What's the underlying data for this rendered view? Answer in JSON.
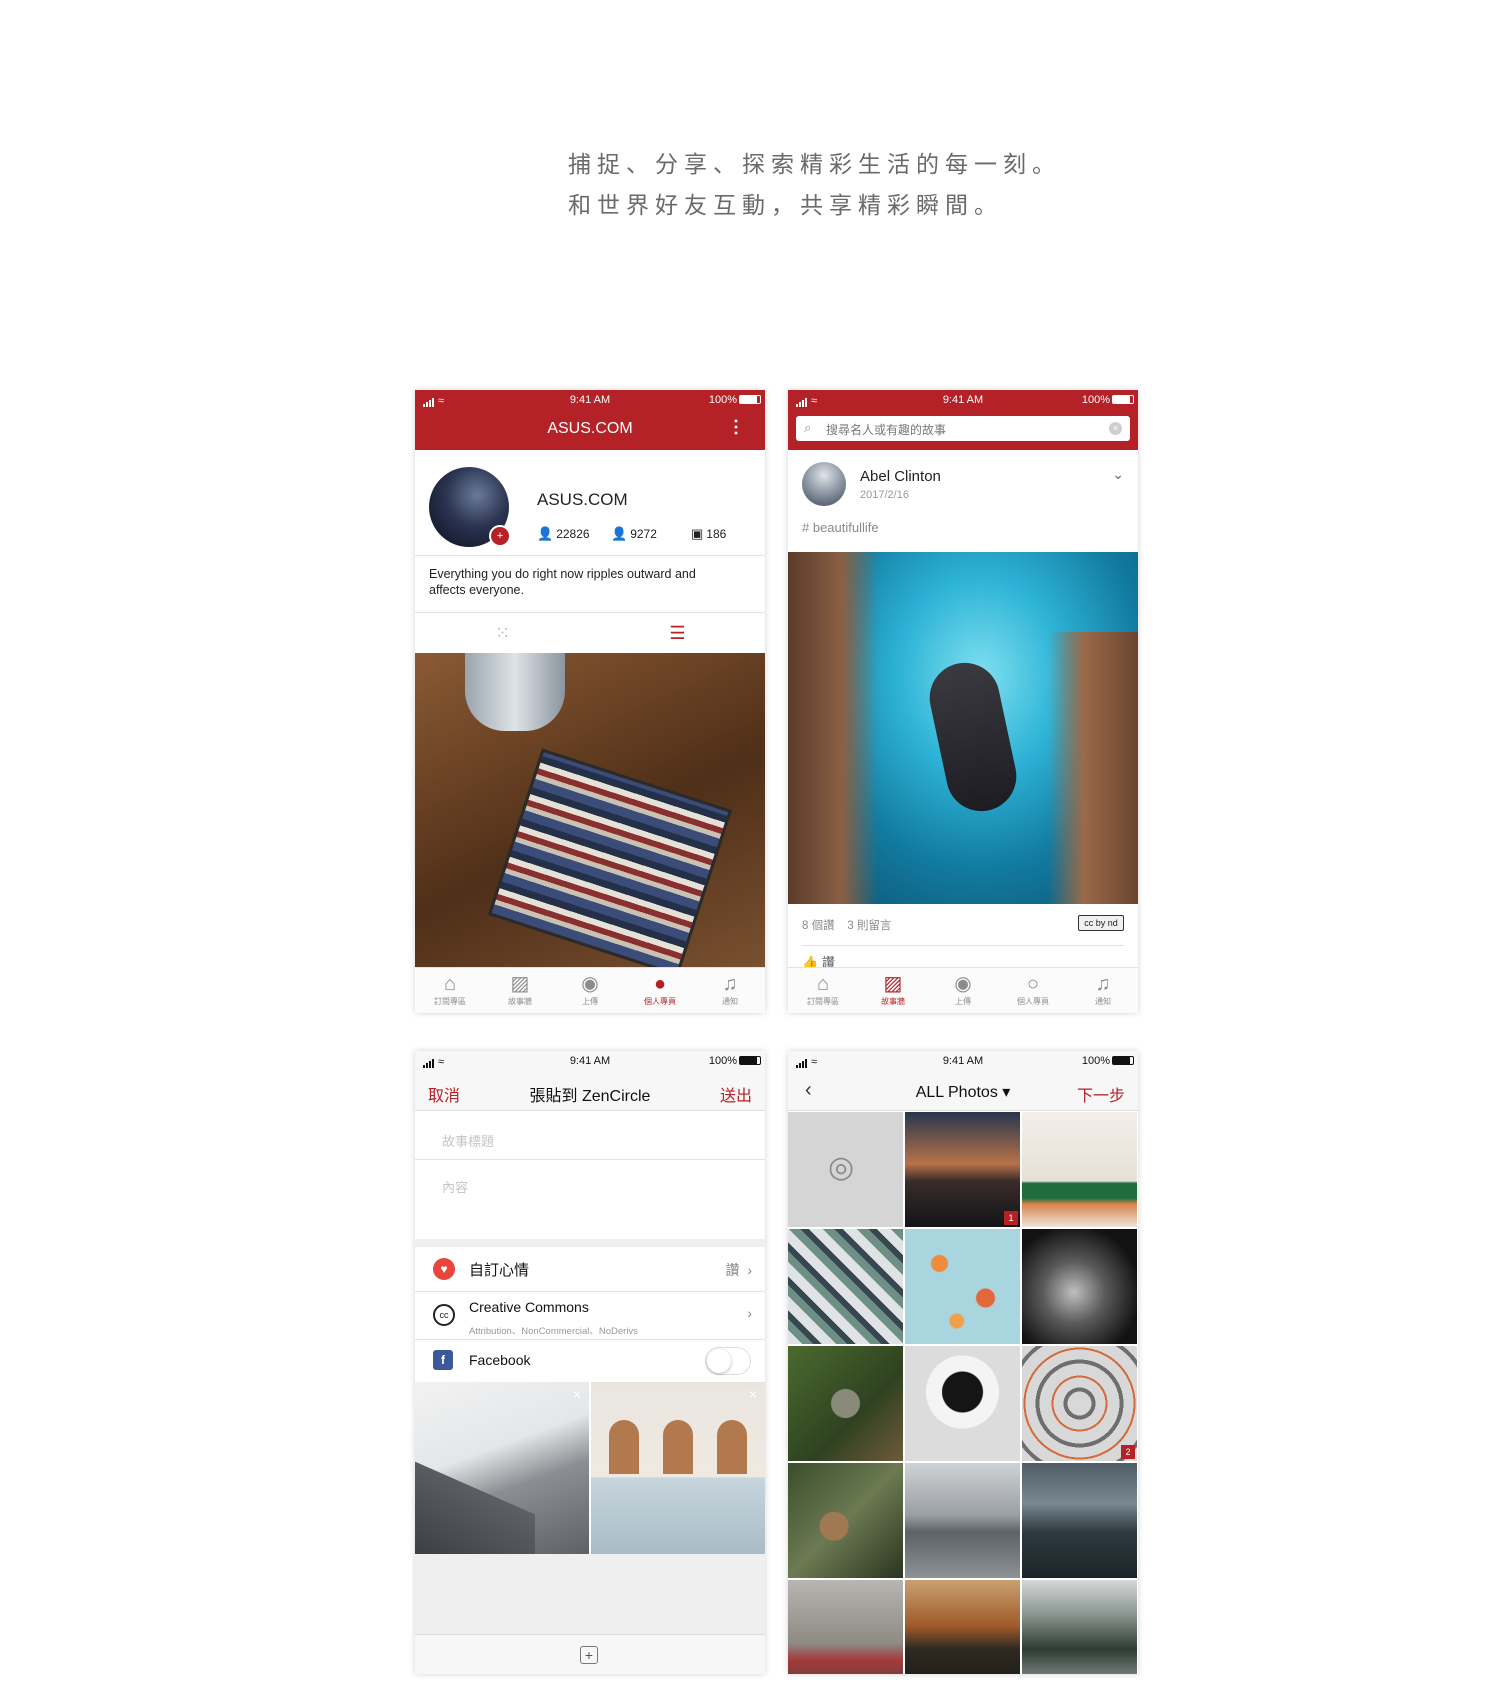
{
  "tagline": {
    "line1": "捕捉、分享、探索精彩生活的每一刻。",
    "line2": "和世界好友互動，共享精彩瞬間。"
  },
  "status": {
    "time": "9:41 AM",
    "battery": "100%"
  },
  "colors": {
    "accent": "#b42126",
    "text": "#222222",
    "muted": "#8a8a8a"
  },
  "tabbar": {
    "items": [
      {
        "label": "訂閱專區",
        "icon": "home-icon"
      },
      {
        "label": "故事牆",
        "icon": "gallery-icon"
      },
      {
        "label": "上傳",
        "icon": "camera-icon"
      },
      {
        "label": "個人專頁",
        "icon": "person-icon"
      },
      {
        "label": "通知",
        "icon": "bell-icon"
      }
    ]
  },
  "profile": {
    "header_title": "ASUS.COM",
    "name": "ASUS.COM",
    "followers": "22826",
    "following": "9272",
    "stories": "186",
    "bio": "Everything you do right now ripples outward and affects everyone."
  },
  "feed": {
    "search_placeholder": "搜尋名人或有趣的故事",
    "author": "Abel Clinton",
    "date": "2017/2/16",
    "tag": "# beautifullife",
    "likes": "8 個讚",
    "comments": "3 則留言",
    "license": "cc by nd",
    "like_label": "讚"
  },
  "compose": {
    "cancel": "取消",
    "title": "張貼到 ZenCircle",
    "send": "送出",
    "title_placeholder": "故事標題",
    "content_placeholder": "內容",
    "mood_label": "自訂心情",
    "mood_value": "讚",
    "cc_label": "Creative Commons",
    "cc_sub": "Attribution、NonCommercial、NoDerivs",
    "facebook_label": "Facebook",
    "facebook_enabled": false
  },
  "picker": {
    "title": "ALL Photos",
    "next": "下一步",
    "selected": [
      "1",
      "2"
    ]
  }
}
